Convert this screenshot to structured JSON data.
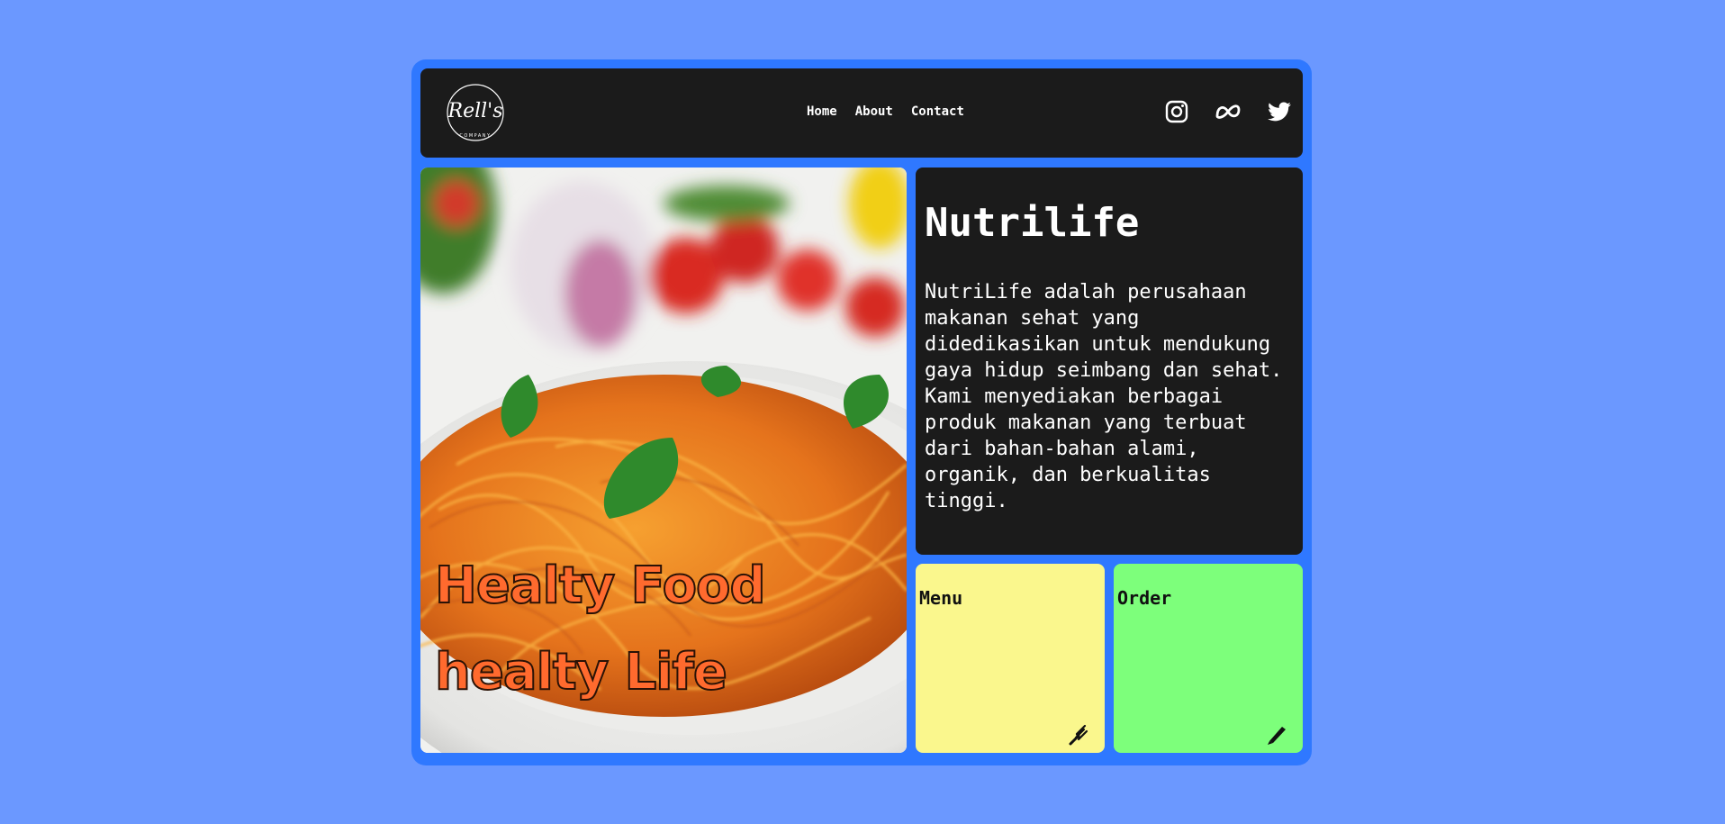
{
  "colors": {
    "page_bg": "#6b98ff",
    "frame": "#2f78ff",
    "dark_panel": "#1b1b1b",
    "menu_card": "#faf78d",
    "order_card": "#7dff7b",
    "hero_text": "#ff6a2e"
  },
  "nav": {
    "logo_icon": "rells-company-logo",
    "links": [
      "Home",
      "About",
      "Contact"
    ],
    "socials": [
      "instagram-icon",
      "meta-icon",
      "twitter-icon"
    ]
  },
  "hero": {
    "line1": "Healty Food",
    "line2": "healty Life",
    "image": "spaghetti-plate"
  },
  "info": {
    "title": "Nutrilife",
    "description": "NutriLife adalah perusahaan makanan sehat yang didedikasikan untuk mendukung gaya hidup seimbang dan sehat. Kami menyediakan berbagai produk makanan yang terbuat dari bahan-bahan alami, organik, dan berkualitas tinggi."
  },
  "cards": {
    "menu": {
      "label": "Menu",
      "icon": "fork-icon"
    },
    "order": {
      "label": "Order",
      "icon": "pen-icon"
    }
  }
}
